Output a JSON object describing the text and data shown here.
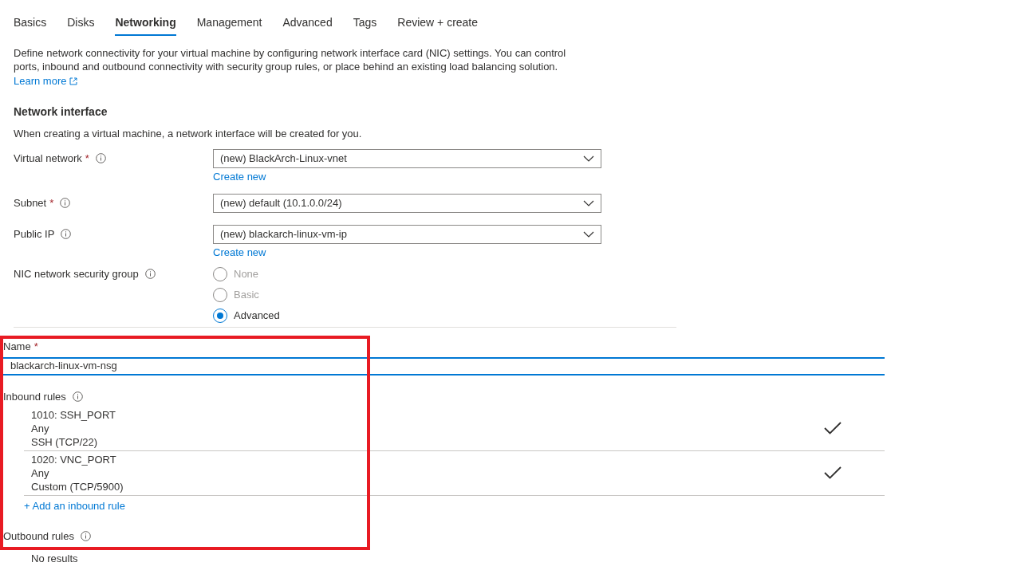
{
  "tabs": [
    {
      "label": "Basics",
      "selected": false
    },
    {
      "label": "Disks",
      "selected": false
    },
    {
      "label": "Networking",
      "selected": true
    },
    {
      "label": "Management",
      "selected": false
    },
    {
      "label": "Advanced",
      "selected": false
    },
    {
      "label": "Tags",
      "selected": false
    },
    {
      "label": "Review + create",
      "selected": false
    }
  ],
  "intro": {
    "text": "Define network connectivity for your virtual machine by configuring network interface card (NIC) settings. You can control ports, inbound and outbound connectivity with security group rules, or place behind an existing load balancing solution.",
    "link": "Learn more"
  },
  "network_interface": {
    "heading": "Network interface",
    "description": "When creating a virtual machine, a network interface will be created for you.",
    "fields": [
      {
        "label": "Virtual network",
        "required_mark": "*",
        "value": "(new) BlackArch-Linux-vnet",
        "link": "Create new"
      },
      {
        "label": "Subnet",
        "required_mark": "*",
        "value": "(new) default (10.1.0.0/24)"
      },
      {
        "label": "Public IP",
        "value": "(new) blackarch-linux-vm-ip",
        "link": "Create new"
      }
    ],
    "security_group": {
      "label": "NIC network security group",
      "options": [
        {
          "label": "None",
          "selected": false,
          "disabled": true
        },
        {
          "label": "Basic",
          "selected": false,
          "disabled": true
        },
        {
          "label": "Advanced",
          "selected": true,
          "disabled": false
        }
      ]
    }
  },
  "nsg": {
    "name_label": "Name",
    "name_required_mark": "*",
    "name_value": "blackarch-linux-vm-nsg",
    "inbound_label": "Inbound rules",
    "inbound_rules": [
      {
        "title": "1010: SSH_PORT",
        "source": "Any",
        "service": "SSH (TCP/22)",
        "checked": true
      },
      {
        "title": "1020: VNC_PORT",
        "source": "Any",
        "service": "Custom (TCP/5900)",
        "checked": true
      }
    ],
    "add_inbound": "+ Add an inbound rule",
    "outbound_label": "Outbound rules",
    "outbound_empty": "No results"
  }
}
